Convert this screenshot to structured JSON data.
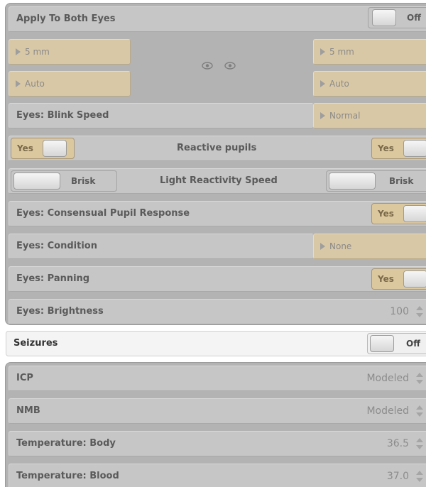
{
  "eyes": {
    "apply_both": {
      "label": "Apply To Both Eyes",
      "toggle": "Off"
    },
    "pupil_size": {
      "left": "5 mm",
      "right": "5 mm"
    },
    "mode": {
      "left": "Auto",
      "right": "Auto"
    },
    "blink": {
      "label": "Eyes: Blink Speed",
      "value": "Normal"
    },
    "reactive": {
      "left": "Yes",
      "label": "Reactive pupils",
      "right": "Yes"
    },
    "reactivity_speed": {
      "left": "Brisk",
      "label": "Light Reactivity Speed",
      "right": "Brisk"
    },
    "consensual": {
      "label": "Eyes: Consensual Pupil Response",
      "toggle": "Yes"
    },
    "condition": {
      "label": "Eyes: Condition",
      "value": "None"
    },
    "panning": {
      "label": "Eyes: Panning",
      "toggle": "Yes"
    },
    "brightness": {
      "label": "Eyes: Brightness",
      "value": "100"
    }
  },
  "seizures": {
    "label": "Seizures",
    "toggle": "Off"
  },
  "physio": {
    "icp": {
      "label": "ICP",
      "value": "Modeled"
    },
    "nmb": {
      "label": "NMB",
      "value": "Modeled"
    },
    "temp_body": {
      "label": "Temperature: Body",
      "value": "36.5"
    },
    "temp_blood": {
      "label": "Temperature: Blood",
      "value": "37.0"
    }
  },
  "colors": {
    "panel": "#b3b3b3",
    "row": "#c6c6c6",
    "accent": "#d9c8a6"
  },
  "icons": {
    "dropdown": "triangle-right-icon",
    "eye": "eye-icon",
    "spinner": "spinner-arrows-icon"
  }
}
